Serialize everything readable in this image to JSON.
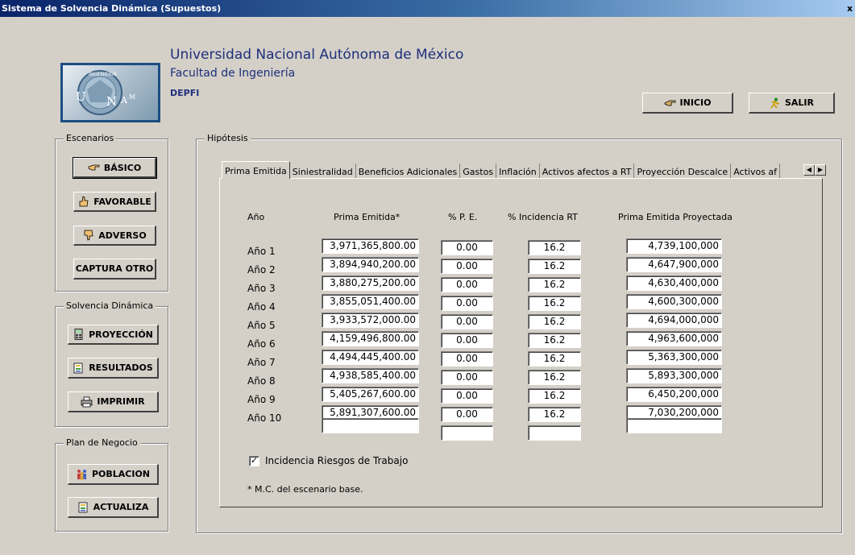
{
  "window": {
    "title": "Sistema de Solvencia Dinámica (Supuestos)",
    "close_glyph": "x"
  },
  "header": {
    "university": "Universidad Nacional Autónoma de México",
    "faculty": "Facultad de Ingeniería",
    "division": "DEPFI",
    "logo_text": {
      "u": "U",
      "n": "N",
      "a": "A",
      "m": "M",
      "seal": "INGENIERÍA"
    }
  },
  "top_buttons": {
    "inicio": "INICIO",
    "salir": "SALIR"
  },
  "sidebar": {
    "escenarios": {
      "legend": "Escenarios",
      "basico": "BÁSICO",
      "favorable": "FAVORABLE",
      "adverso": "ADVERSO",
      "captura": "CAPTURA OTRO"
    },
    "solvencia": {
      "legend": "Solvencia Dinámica",
      "proyeccion": "PROYECCIÓN",
      "resultados": "RESULTADOS",
      "imprimir": "IMPRIMIR"
    },
    "plan": {
      "legend": "Plan de Negocio",
      "poblacion": "POBLACION",
      "actualiza": "ACTUALIZA"
    }
  },
  "hipotesis": {
    "legend": "Hipótesis",
    "tabs": [
      "Prima Emitida",
      "Siniestralidad",
      "Beneficios Adicionales",
      "Gastos",
      "Inflación",
      "Activos afectos a RT",
      "Proyección Descalce",
      "Activos af"
    ],
    "active_tab": 0,
    "columns": {
      "year": "Año",
      "prima": "Prima Emitida*",
      "pe": "% P. E.",
      "incidencia": "% Incidencia RT",
      "proyectada": "Prima Emitida Proyectada"
    },
    "rows": [
      {
        "year": "Año 1",
        "prima": "3,971,365,800.00",
        "pe": "0.00",
        "incidencia": "16.2",
        "proyectada": "4,739,100,000"
      },
      {
        "year": "Año 2",
        "prima": "3,894,940,200.00",
        "pe": "0.00",
        "incidencia": "16.2",
        "proyectada": "4,647,900,000"
      },
      {
        "year": "Año 3",
        "prima": "3,880,275,200.00",
        "pe": "0.00",
        "incidencia": "16.2",
        "proyectada": "4,630,400,000"
      },
      {
        "year": "Año 4",
        "prima": "3,855,051,400.00",
        "pe": "0.00",
        "incidencia": "16.2",
        "proyectada": "4,600,300,000"
      },
      {
        "year": "Año 5",
        "prima": "3,933,572,000.00",
        "pe": "0.00",
        "incidencia": "16.2",
        "proyectada": "4,694,000,000"
      },
      {
        "year": "Año 6",
        "prima": "4,159,496,800.00",
        "pe": "0.00",
        "incidencia": "16.2",
        "proyectada": "4,963,600,000"
      },
      {
        "year": "Año 7",
        "prima": "4,494,445,400.00",
        "pe": "0.00",
        "incidencia": "16.2",
        "proyectada": "5,363,300,000"
      },
      {
        "year": "Año 8",
        "prima": "4,938,585,400.00",
        "pe": "0.00",
        "incidencia": "16.2",
        "proyectada": "5,893,300,000"
      },
      {
        "year": "Año 9",
        "prima": "5,405,267,600.00",
        "pe": "0.00",
        "incidencia": "16.2",
        "proyectada": "6,450,200,000"
      },
      {
        "year": "Año 10",
        "prima": "5,891,307,600.00",
        "pe": "0.00",
        "incidencia": "16.2",
        "proyectada": "7,030,200,000"
      }
    ],
    "checkbox_label": "Incidencia Riesgos de Trabajo",
    "checkbox_checked": true,
    "checkbox_glyph": "✓",
    "footnote": "* M.C. del escenario base."
  }
}
